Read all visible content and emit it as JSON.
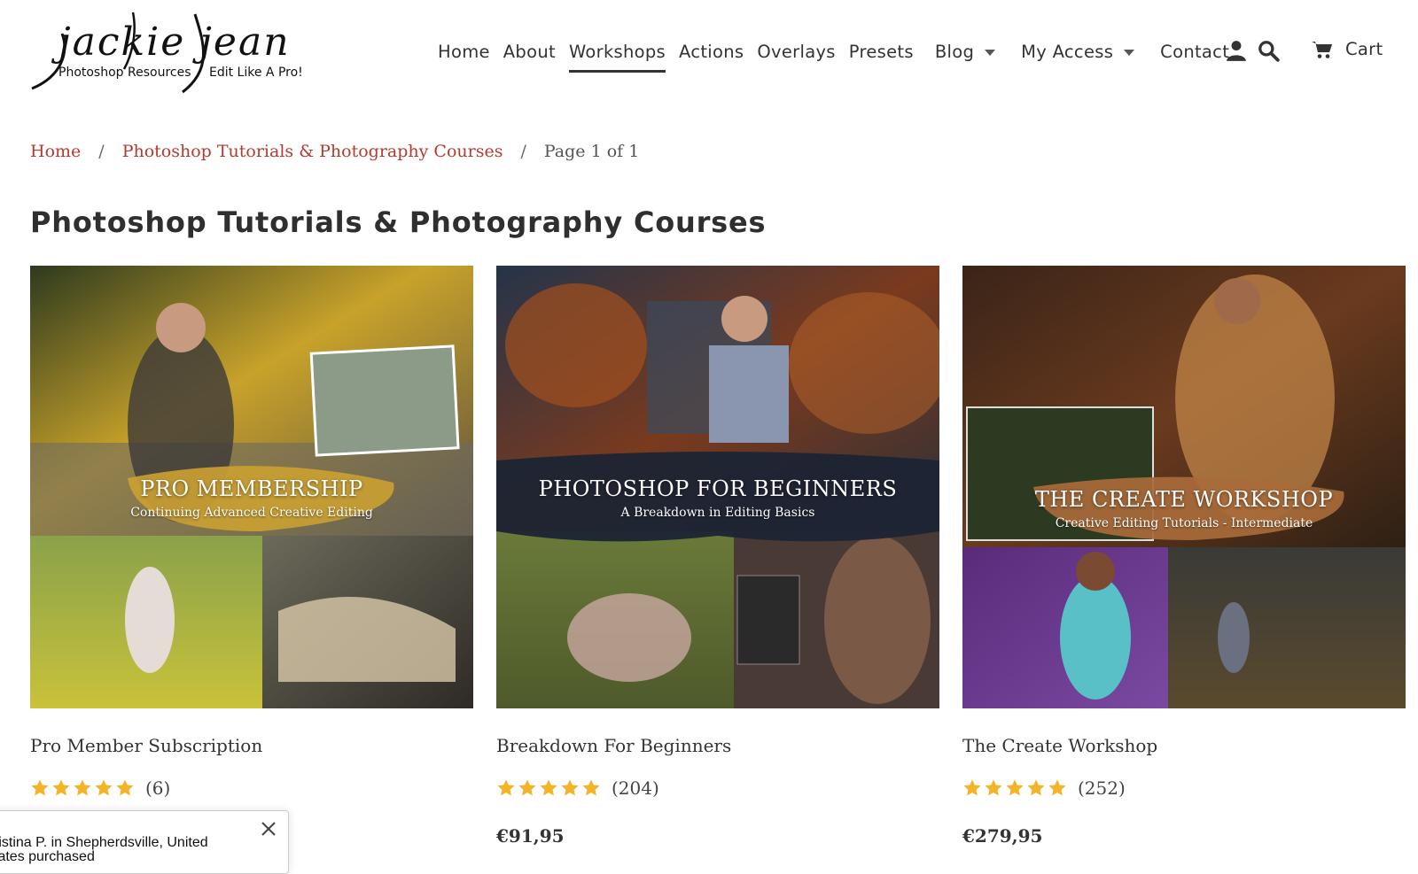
{
  "brand": {
    "logo_script": "jackie jean",
    "logo_tagline_left": "Photoshop Resources",
    "logo_tagline_right": "Edit Like A Pro!"
  },
  "nav": {
    "items": [
      {
        "label": "Home"
      },
      {
        "label": "About"
      },
      {
        "label": "Workshops",
        "active": true
      },
      {
        "label": "Actions"
      },
      {
        "label": "Overlays"
      },
      {
        "label": "Presets"
      },
      {
        "label": "Blog",
        "dropdown": true
      },
      {
        "label": "My Access",
        "dropdown": true
      },
      {
        "label": "Contact"
      }
    ],
    "account_icon": "user-icon",
    "search_icon": "search-icon",
    "cart_icon": "cart-icon",
    "cart_label": "Cart"
  },
  "breadcrumb": {
    "home": "Home",
    "collection": "Photoshop Tutorials & Photography Courses",
    "separator": "/",
    "current": "Page 1 of 1"
  },
  "page": {
    "title": "Photoshop Tutorials & Photography Courses"
  },
  "products": [
    {
      "banner_title": "PRO MEMBERSHIP",
      "banner_subtitle": "Continuing Advanced Creative Editing",
      "name": "Pro Member Subscription",
      "rating": 5,
      "reviews": "(6)",
      "price": ""
    },
    {
      "banner_title": "PHOTOSHOP FOR BEGINNERS",
      "banner_subtitle": "A Breakdown in Editing Basics",
      "name": "Breakdown For Beginners",
      "rating": 5,
      "reviews": "(204)",
      "price": "€91,95"
    },
    {
      "banner_title": "THE CREATE WORKSHOP",
      "banner_subtitle": "Creative Editing Tutorials - Intermediate",
      "name": "The Create Workshop",
      "rating": 5,
      "reviews": "(252)",
      "price": "€279,95"
    }
  ],
  "popup": {
    "line1": "ristina P. in Shepherdsville, United",
    "line2": "tates purchased",
    "close_icon": "close-icon"
  },
  "colors": {
    "link": "#b53a2e",
    "star": "#f2b52a",
    "text": "#333333"
  }
}
